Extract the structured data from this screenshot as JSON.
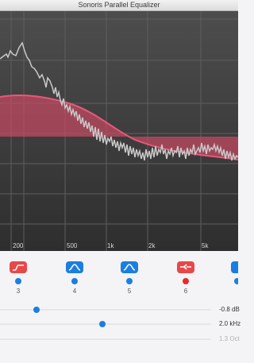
{
  "window": {
    "title": "Sonoris Parallel Equalizer"
  },
  "graph": {
    "freq_labels": [
      "200",
      "500",
      "1k",
      "2k",
      "5k"
    ]
  },
  "bands": [
    {
      "number": "3",
      "filter_icon": "low-cut-filter-icon",
      "color": "#e84848",
      "dot_color": "#1a7fe0"
    },
    {
      "number": "4",
      "filter_icon": "bell-filter-icon",
      "color": "#1a7fe0",
      "dot_color": "#1a7fe0"
    },
    {
      "number": "5",
      "filter_icon": "bell-filter-icon",
      "color": "#1a7fe0",
      "dot_color": "#1a7fe0"
    },
    {
      "number": "6",
      "filter_icon": "notch-filter-icon",
      "color": "#e84848",
      "dot_color": "#e82a2a"
    },
    {
      "number": "",
      "filter_icon": "filter-icon",
      "color": "#1a7fe0",
      "dot_color": "#1a7fe0"
    }
  ],
  "params": {
    "gain": {
      "value": "-0.8 dB",
      "level": 0.17
    },
    "frequency": {
      "value": "2.0 kHz",
      "level": 0.49
    },
    "bandwidth": {
      "value": "1.3 Oct"
    }
  }
}
